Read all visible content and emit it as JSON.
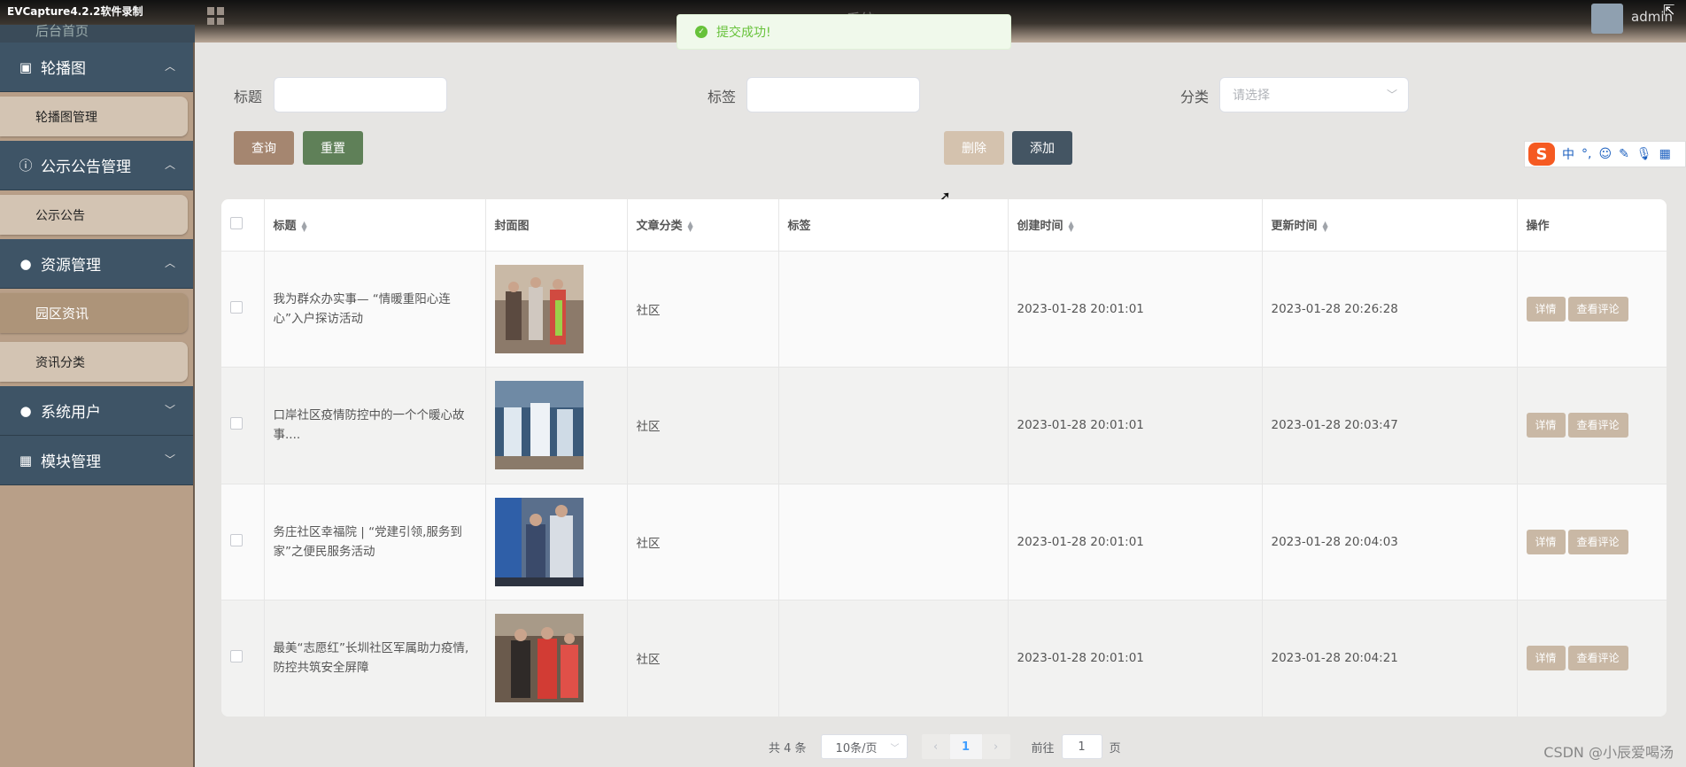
{
  "recorder_label": "EVCapture4.2.2软件录制",
  "header": {
    "system_title": "…系统",
    "username": "admin"
  },
  "toast": {
    "message": "提交成功!"
  },
  "sidebar": {
    "top_remnant": "后台首页",
    "groups": [
      {
        "label": "轮播图",
        "icon": "image-icon",
        "expanded": true,
        "items": [
          {
            "label": "轮播图管理",
            "active": false
          }
        ]
      },
      {
        "label": "公示公告管理",
        "icon": "info-circle-icon",
        "expanded": true,
        "items": [
          {
            "label": "公示公告",
            "active": false
          }
        ]
      },
      {
        "label": "资源管理",
        "icon": "bulb-icon",
        "expanded": true,
        "items": [
          {
            "label": "园区资讯",
            "active": true
          },
          {
            "label": "资讯分类",
            "active": false
          }
        ]
      },
      {
        "label": "系统用户",
        "icon": "user-icon",
        "expanded": false,
        "items": []
      },
      {
        "label": "模块管理",
        "icon": "grid-icon",
        "expanded": false,
        "items": []
      }
    ]
  },
  "search": {
    "title_label": "标题",
    "tag_label": "标签",
    "category_label": "分类",
    "category_placeholder": "请选择",
    "query_button": "查询",
    "reset_button": "重置",
    "delete_button": "删除",
    "add_button": "添加"
  },
  "ime": {
    "logo": "S",
    "mode": "中"
  },
  "table": {
    "headers": [
      "标题",
      "封面图",
      "文章分类",
      "标签",
      "创建时间",
      "更新时间",
      "操作"
    ],
    "rows": [
      {
        "title": "我为群众办实事— “情暖重阳心连心”入户探访活动",
        "category": "社区",
        "tag": "",
        "created": "2023-01-28 20:01:01",
        "updated": "2023-01-28 20:26:28"
      },
      {
        "title": "口岸社区疫情防控中的一个个暖心故事....",
        "category": "社区",
        "tag": "",
        "created": "2023-01-28 20:01:01",
        "updated": "2023-01-28 20:03:47"
      },
      {
        "title": "务庄社区幸福院 | “党建引领,服务到家”之便民服务活动",
        "category": "社区",
        "tag": "",
        "created": "2023-01-28 20:01:01",
        "updated": "2023-01-28 20:04:03"
      },
      {
        "title": "最美“志愿红”长圳社区军属助力疫情,防控共筑安全屏障",
        "category": "社区",
        "tag": "",
        "created": "2023-01-28 20:01:01",
        "updated": "2023-01-28 20:04:21"
      }
    ],
    "detail_label": "详情",
    "comment_label": "查看评论"
  },
  "pagination": {
    "total_text": "共 4 条",
    "page_size": "10条/页",
    "current_page": "1",
    "goto_label": "前往",
    "goto_value": "1",
    "page_suffix": "页"
  },
  "watermark": "CSDN @小辰爱喝汤"
}
